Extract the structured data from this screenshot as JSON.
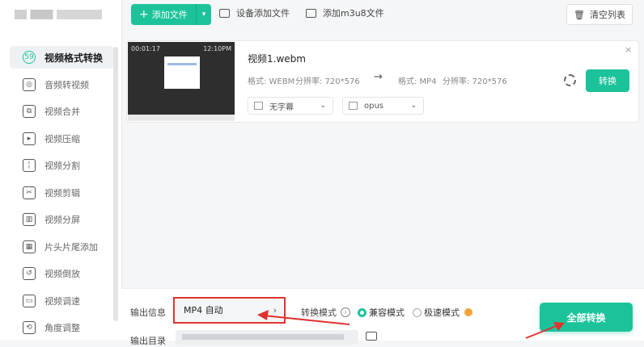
{
  "sidebar": {
    "items": [
      {
        "label": "视频格式转换",
        "icon": "video-convert-icon",
        "glyph": "59",
        "active": true
      },
      {
        "label": "音频转视频",
        "icon": "audio-to-video-icon",
        "glyph": "◎"
      },
      {
        "label": "视频合并",
        "icon": "video-merge-icon",
        "glyph": "⧉"
      },
      {
        "label": "视频压缩",
        "icon": "video-compress-icon",
        "glyph": "▸"
      },
      {
        "label": "视频分割",
        "icon": "video-split-icon",
        "glyph": "╎"
      },
      {
        "label": "视频剪辑",
        "icon": "video-edit-icon",
        "glyph": "✂"
      },
      {
        "label": "视频分屏",
        "icon": "split-screen-icon",
        "glyph": "▥"
      },
      {
        "label": "片头片尾添加",
        "icon": "intro-outro-icon",
        "glyph": "▦"
      },
      {
        "label": "视频倒放",
        "icon": "video-reverse-icon",
        "glyph": "↺"
      },
      {
        "label": "视频调速",
        "icon": "video-speed-icon",
        "glyph": "▭"
      },
      {
        "label": "角度调整",
        "icon": "angle-adjust-icon",
        "glyph": "⟲"
      }
    ]
  },
  "toolbar": {
    "add_file": "添加文件",
    "add_device": "设备添加文件",
    "add_m3u8": "添加m3u8文件",
    "clear_list": "清空列表"
  },
  "file": {
    "name": "视频1.webm",
    "thumb_time_start": "00:01:17",
    "thumb_time_end": "12:10PM",
    "src_format": "格式: WEBM",
    "src_resolution": "分辨率: 720*576",
    "dst_format": "格式: MP4",
    "dst_resolution": "分辨率: 720*576",
    "subtitle": "无字幕",
    "audio": "opus",
    "convert": "转换"
  },
  "output": {
    "info_label": "输出信息",
    "format_value": "MP4 自动",
    "mode_label": "转换模式",
    "mode_compat": "兼容模式",
    "mode_fast": "极速模式",
    "dir_label": "输出目录",
    "convert_all": "全部转换"
  },
  "colors": {
    "accent": "#1cc39a",
    "annotation": "#e0332f",
    "vip": "#f3a33b"
  }
}
